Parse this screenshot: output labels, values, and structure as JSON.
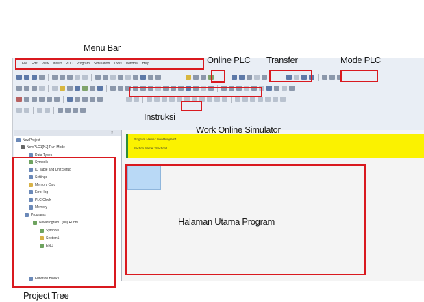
{
  "labels": {
    "menu_bar": "Menu Bar",
    "online_plc": "Online PLC",
    "transfer": "Transfer",
    "mode_plc": "Mode PLC",
    "instruksi": "Instruksi",
    "work_online_simulator": "Work Online Simulator",
    "halaman_utama_program": "Halaman Utama Program",
    "project_tree": "Project Tree"
  },
  "menu": {
    "items": [
      "File",
      "Edit",
      "View",
      "Insert",
      "PLC",
      "Program",
      "Simulation",
      "Tools",
      "Window",
      "Help"
    ]
  },
  "project_tree": {
    "root": "NewProject",
    "plc_node": "NewPLC1[NJ] Run Mode",
    "items": [
      "Data Types",
      "Symbols",
      "IO Table and Unit Setup",
      "Settings",
      "Memory Card",
      "Error log",
      "PLC Clock",
      "Memory",
      "Programs"
    ],
    "program_node": "NewProgram1 (00) Runni",
    "program_children": [
      "Symbols",
      "Section1",
      "END"
    ],
    "function_blocks": "Function Blocks"
  },
  "program": {
    "program_name": "Program Name : NewProgram1",
    "section_name": "Section Name : Section1"
  },
  "colors": {
    "annotation_red": "#d9191f",
    "program_header_yellow": "#fbf200",
    "cell_cursor_blue": "#b9d9f6"
  }
}
